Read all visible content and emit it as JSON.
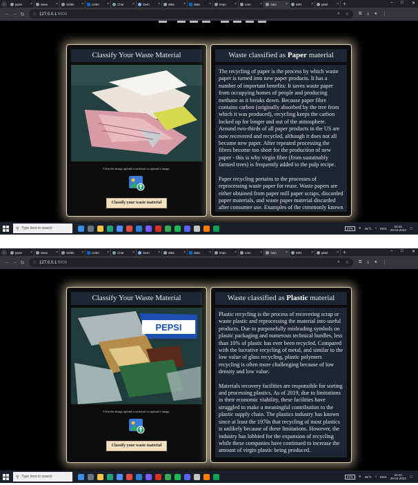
{
  "browser": {
    "tabs": [
      "jaysc",
      "www.",
      "Settin",
      "Linke",
      "Char",
      "Gem",
      "data",
      "data",
      "impo",
      "com",
      "Awo",
      "IMG",
      "plast"
    ],
    "active_tab_index": 10,
    "url_host": "127.0.0.1",
    "url_port": ":5000"
  },
  "taskbar": {
    "search_placeholder": "Type here to search",
    "battery": "37%",
    "temperature": "26°C",
    "language": "ENG"
  },
  "screens": [
    {
      "time": "04:45",
      "date": "29-04-2024",
      "left_panel": {
        "title": "Classify Your Waste Material",
        "upload_hint": "Click the image upload icon below to upload a image:",
        "button_label": "Classify your waste material"
      },
      "right_panel": {
        "title_prefix": "Waste classified as",
        "material": "Paper",
        "title_suffix": "material",
        "paragraphs": [
          "The recycling of paper is the process by which waste paper is turned into new paper products. It has a number of important benefits: It saves waste paper from occupying homes of people and producing methane as it breaks down. Because paper fibre contains carbon (originally absorbed by the tree from which it was produced), recycling keeps the carbon locked up for longer and out of the atmosphere. Around two-thirds of all paper products in the US are now recovered and recycled, although it does not all become new paper. After repeated processing the fibres become too short for the production of new paper - this is why virgin fibre (from sustainably farmed trees) is frequently added to the pulp recipe.",
          "Paper recycling pertains to the processes of reprocessing waste paper for reuse. Waste papers are either obtained from paper mill paper scraps, discarded paper materials, and waste paper material discarded after consumer use. Examples of the commonly known papers recycled are old newspapers and magazines."
        ]
      }
    },
    {
      "time": "04:42",
      "date": "29-04-2024",
      "left_panel": {
        "title": "Classify Your Waste Material",
        "upload_hint": "Click the image upload icon below to upload a image:",
        "button_label": "Classify your waste material"
      },
      "right_panel": {
        "title_prefix": "Waste classified as",
        "material": "Plastic",
        "title_suffix": "material",
        "paragraphs": [
          "Plastic recycling is the process of recovering scrap or waste plastic and reprocessing the material into useful products. Due to purposefully misleading symbols on plastic packaging and numerous technical hurdles, less than 10% of plastic has ever been recycled. Compared with the lucrative recycling of metal, and similar to the low value of glass recycling, plastic polymers recycling is often more challenging because of low density and low value.",
          "Materials recovery facilities are responsible for sorting and processing plastics. As of 2019, due to limitations in their economic viability, these facilities have struggled to make a meaningful contribution to the plastic supply chain. The plastics industry has known since at least the 1970s that recycling of most plastics is unlikely because of these limitations. However, the industry has lobbied for the expansion of recycling while these companies have continued to increase the amount of virgin plastic being produced."
        ]
      }
    }
  ],
  "photo_labels": {
    "bottle_brand": "PEPSI"
  }
}
